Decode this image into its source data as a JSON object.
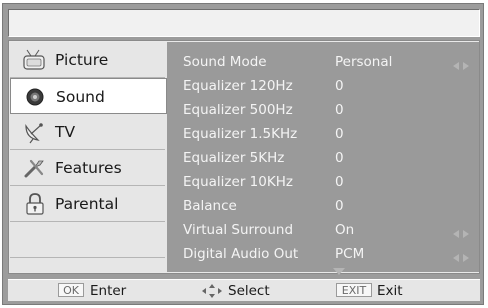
{
  "sidebar": {
    "items": [
      {
        "label": "Picture",
        "icon": "picture-icon",
        "selected": false
      },
      {
        "label": "Sound",
        "icon": "speaker-icon",
        "selected": true
      },
      {
        "label": "TV",
        "icon": "satellite-icon",
        "selected": false
      },
      {
        "label": "Features",
        "icon": "tools-icon",
        "selected": false
      },
      {
        "label": "Parental",
        "icon": "lock-icon",
        "selected": false
      }
    ]
  },
  "settings": {
    "rows": [
      {
        "name": "Sound Mode",
        "value": "Personal",
        "has_arrows": true
      },
      {
        "name": "Equalizer 120Hz",
        "value": "0",
        "has_arrows": false
      },
      {
        "name": "Equalizer 500Hz",
        "value": "0",
        "has_arrows": false
      },
      {
        "name": "Equalizer 1.5KHz",
        "value": "0",
        "has_arrows": false
      },
      {
        "name": "Equalizer 5KHz",
        "value": "0",
        "has_arrows": false
      },
      {
        "name": "Equalizer 10KHz",
        "value": "0",
        "has_arrows": false
      },
      {
        "name": "Balance",
        "value": "0",
        "has_arrows": false
      },
      {
        "name": "Virtual Surround",
        "value": "On",
        "has_arrows": true
      },
      {
        "name": "Digital Audio Out",
        "value": "PCM",
        "has_arrows": true
      }
    ]
  },
  "footer": {
    "ok_key": "OK",
    "ok_label": "Enter",
    "select_label": "Select",
    "exit_key": "EXIT",
    "exit_label": "Exit"
  },
  "colors": {
    "frame": "#9c9c9c",
    "panel": "#e6e6e6",
    "content": "#9a9a9a",
    "selected": "#ffffff"
  }
}
